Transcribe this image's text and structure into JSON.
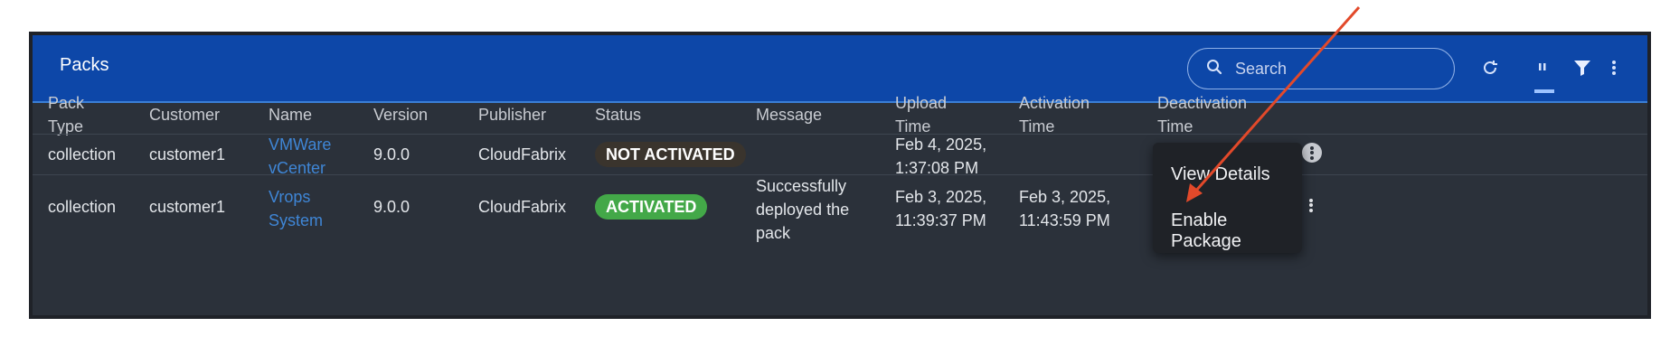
{
  "header": {
    "title": "Packs",
    "search_placeholder": "Search"
  },
  "columns": [
    "Pack\nType",
    "Customer",
    "Name",
    "Version",
    "Publisher",
    "Status",
    "Message",
    "Upload\nTime",
    "Activation\nTime",
    "Deactivation\nTime"
  ],
  "rows": [
    {
      "pack_type": "collection",
      "customer": "customer1",
      "name_line1": "VMWare",
      "name_line2": "vCenter",
      "version": "9.0.0",
      "publisher": "CloudFabrix",
      "status": "NOT ACTIVATED",
      "message_l1": "",
      "message_l2": "",
      "message_l3": "",
      "upload_l1": "Feb 4, 2025,",
      "upload_l2": "1:37:08 PM",
      "activation_l1": "",
      "activation_l2": ""
    },
    {
      "pack_type": "collection",
      "customer": "customer1",
      "name_line1": "Vrops",
      "name_line2": "System",
      "version": "9.0.0",
      "publisher": "CloudFabrix",
      "status": "ACTIVATED",
      "message_l1": "Successfully",
      "message_l2": "deployed the",
      "message_l3": "pack",
      "upload_l1": "Feb 3, 2025,",
      "upload_l2": "11:39:37 PM",
      "activation_l1": "Feb 3, 2025,",
      "activation_l2": "11:43:59 PM"
    }
  ],
  "context_menu": {
    "items": [
      "View Details",
      "Enable Package"
    ]
  },
  "colors": {
    "header_bg": "#0d47a8",
    "panel_bg": "#2b313a",
    "activated_badge": "#43a848",
    "link": "#3f86d6",
    "annotation_arrow": "#e2492a"
  },
  "icons": [
    "search-icon",
    "refresh-icon",
    "columns-icon",
    "filter-icon",
    "more-vert-icon"
  ]
}
